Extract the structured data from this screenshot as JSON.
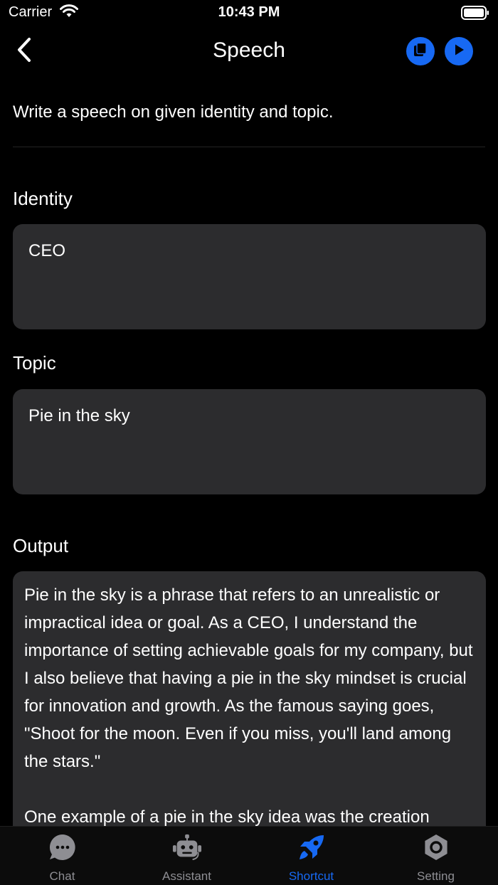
{
  "status_bar": {
    "carrier": "Carrier",
    "time": "10:43 PM"
  },
  "nav": {
    "title": "Speech",
    "back_icon": "chevron-left-icon",
    "copy_icon": "copy-icon",
    "play_icon": "play-icon"
  },
  "description": "Write a speech on given identity and topic.",
  "identity": {
    "label": "Identity",
    "value": "CEO"
  },
  "topic": {
    "label": "Topic",
    "value": "Pie in the sky"
  },
  "output": {
    "label": "Output",
    "text": "Pie in the sky is a phrase that refers to an unrealistic or impractical idea or goal. As a CEO, I understand the importance of setting achievable goals for my company, but I also believe that having a pie in the sky mindset is crucial for innovation and growth. As the famous saying goes, \"Shoot for the moon. Even if you miss, you'll land among the stars.\"\n\nOne example of a pie in the sky idea was the creation"
  },
  "tabs": [
    {
      "label": "Chat",
      "icon": "chat-bubble-icon",
      "active": false
    },
    {
      "label": "Assistant",
      "icon": "robot-icon",
      "active": false
    },
    {
      "label": "Shortcut",
      "icon": "rocket-icon",
      "active": true
    },
    {
      "label": "Setting",
      "icon": "gear-icon",
      "active": false
    }
  ],
  "colors": {
    "accent": "#1769f3",
    "field_bg": "#2c2c2e",
    "inactive_tab": "#8e8e93"
  }
}
